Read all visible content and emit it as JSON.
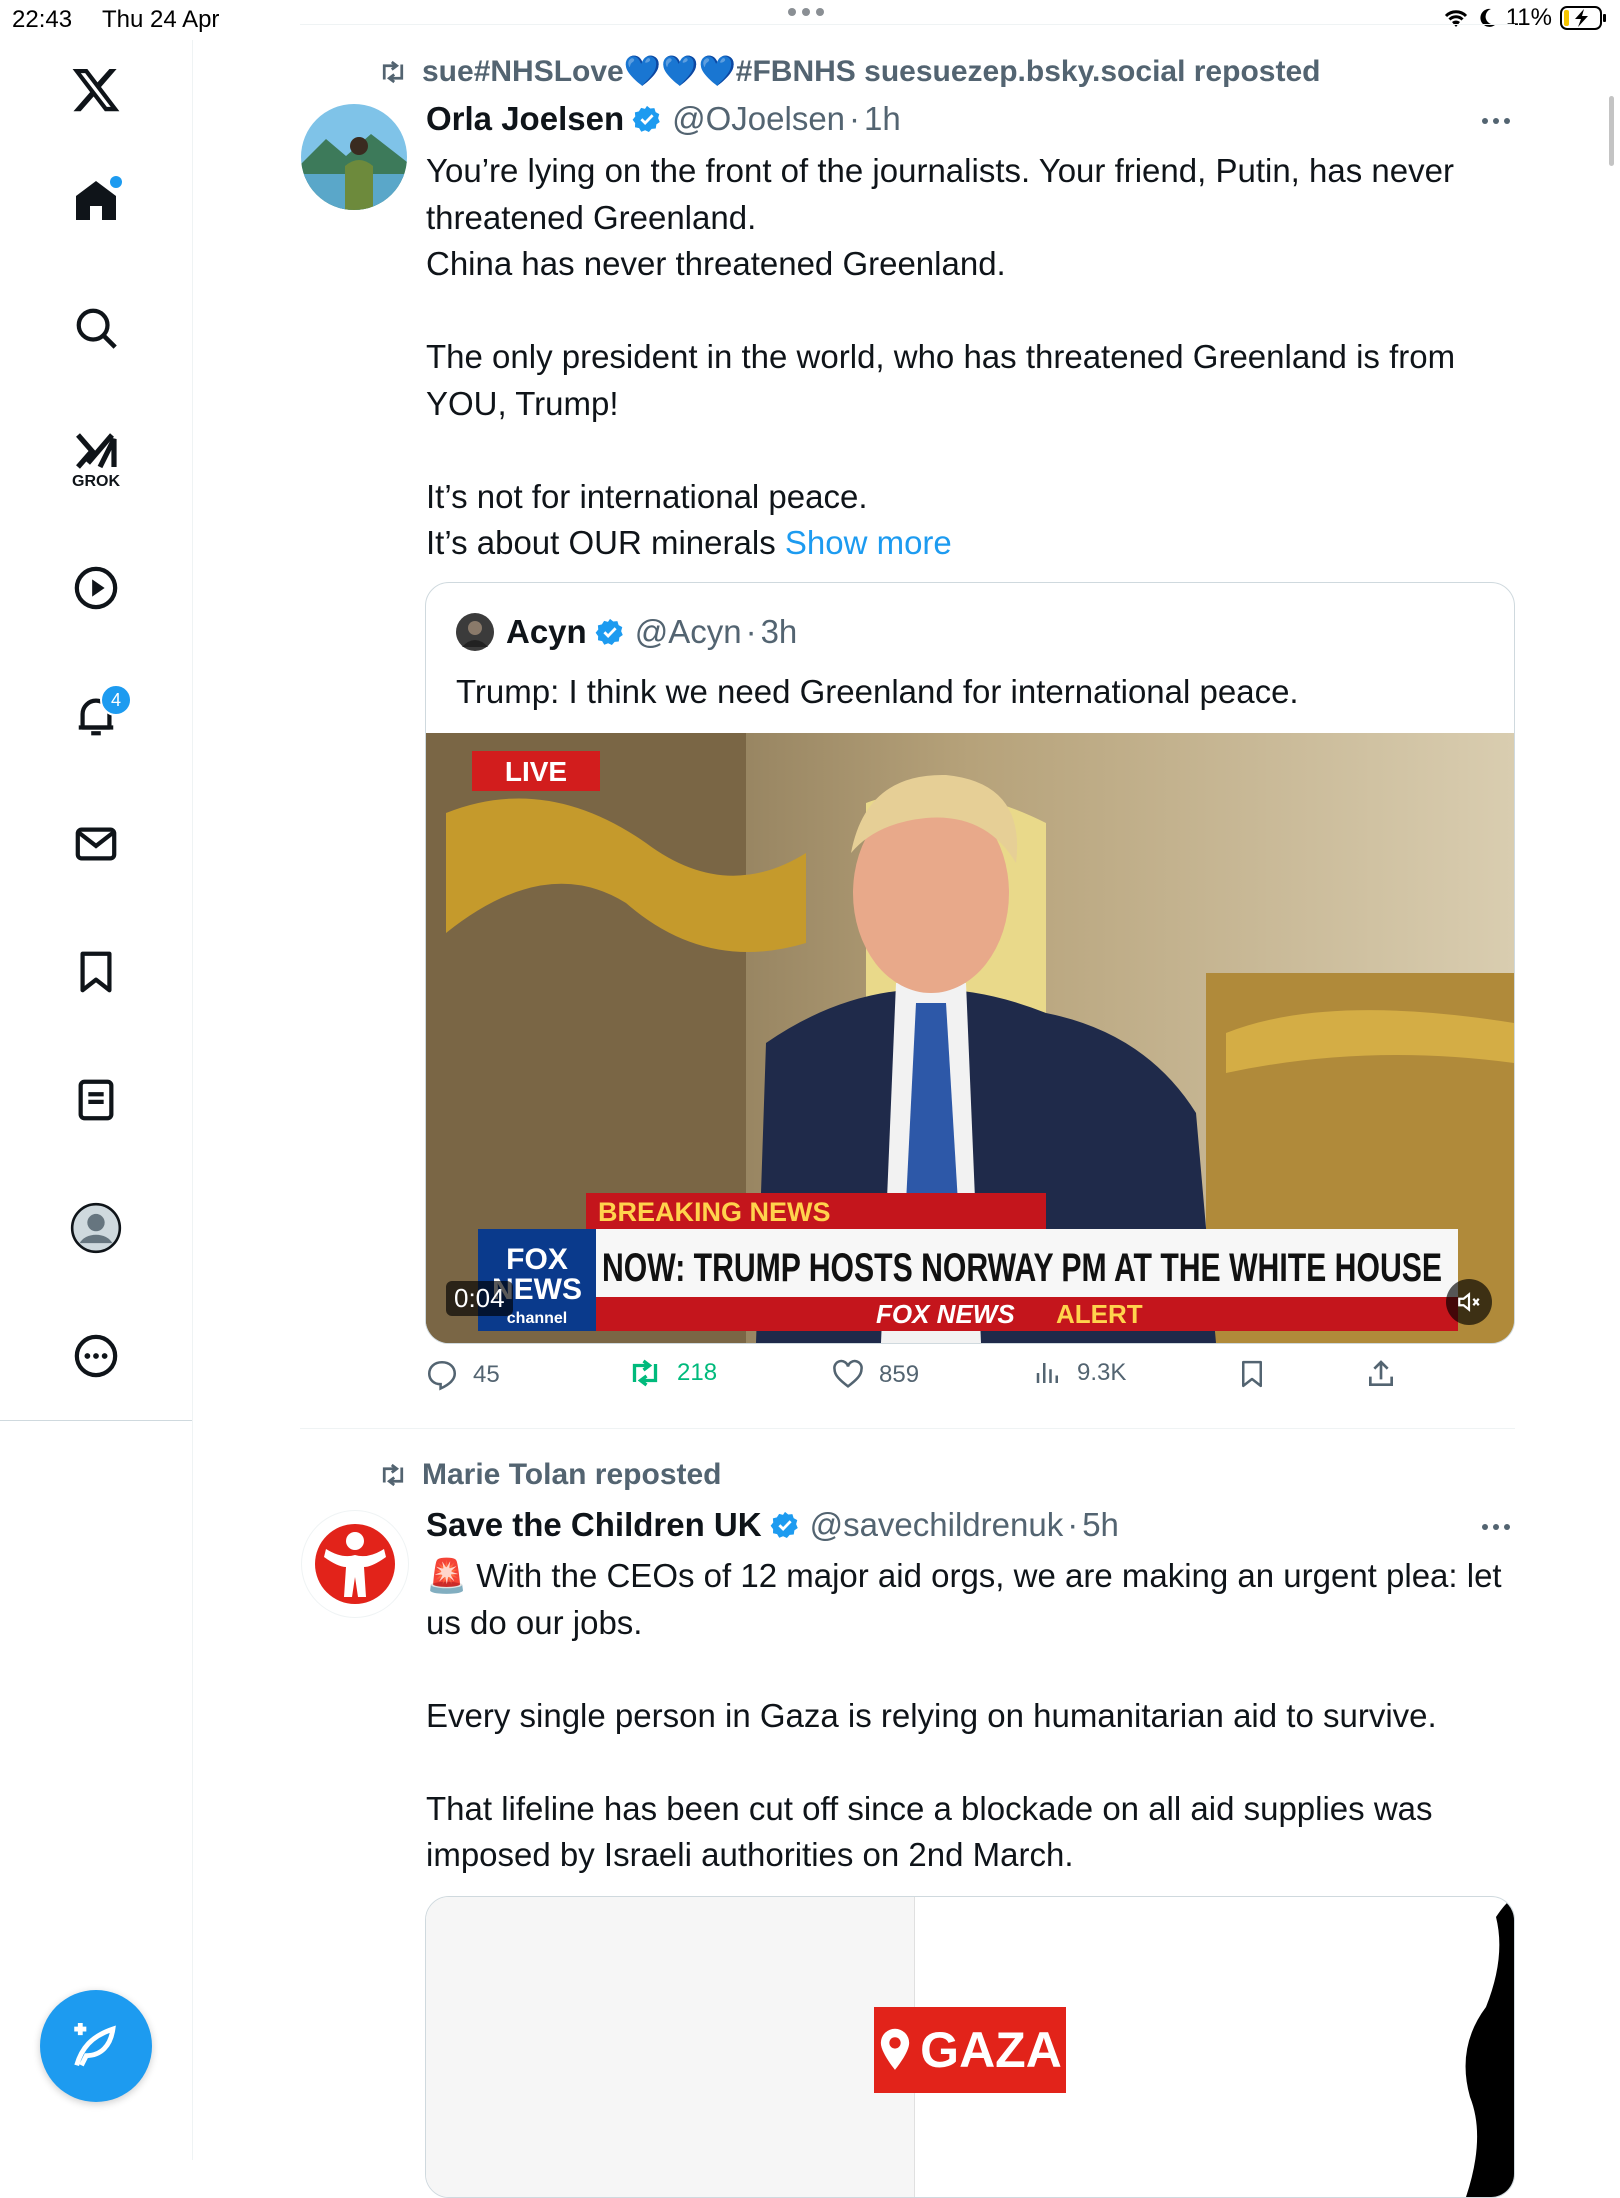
{
  "status_bar": {
    "time": "22:43",
    "date": "Thu 24 Apr",
    "battery": "11%"
  },
  "sidebar": {
    "items": [
      {
        "name": "X"
      },
      {
        "name": "Home"
      },
      {
        "name": "Search"
      },
      {
        "name": "GROK"
      },
      {
        "name": "Videos"
      },
      {
        "name": "Notifications",
        "badge": "4"
      },
      {
        "name": "Messages"
      },
      {
        "name": "Bookmarks"
      },
      {
        "name": "Lists"
      },
      {
        "name": "Profile"
      },
      {
        "name": "More"
      }
    ],
    "grok_label": "GROK",
    "notif_badge": "4"
  },
  "posts": [
    {
      "repost_by": "sue#NHSLove💙💙💙#FBNHS suesuezep.bsky.social reposted",
      "author_name": "Orla Joelsen",
      "handle": "@OJoelsen",
      "time": "1h",
      "paragraphs": [
        "You’re lying on the front of the journalists. Your friend, Putin, has never threatened Greenland.",
        "China has never threatened Greenland.",
        "",
        "The only president in the world, who has threatened Greenland is from YOU, Trump!",
        "",
        "It’s not for international peace."
      ],
      "last_line": "It’s about OUR minerals",
      "show_more": "Show more",
      "quote": {
        "author_name": "Acyn",
        "handle": "@Acyn",
        "time": "3h",
        "text": "Trump: I think we need Greenland for international peace.",
        "video": {
          "live": "LIVE",
          "breaking": "BREAKING NEWS",
          "headline": "NOW: TRUMP HOSTS NORWAY PM AT THE WHITE HOUSE",
          "alert_a": "FOX NEWS",
          "alert_b": "ALERT",
          "logo_a": "FOX",
          "logo_b": "NEWS",
          "logo_c": "channel",
          "timestamp": "0:04"
        }
      },
      "stats": {
        "replies": "45",
        "reposts": "218",
        "likes": "859",
        "views": "9.3K"
      }
    },
    {
      "repost_by": "Marie Tolan reposted",
      "author_name": "Save the Children UK",
      "handle": "@savechildrenuk",
      "time": "5h",
      "line1_emoji": "🚨",
      "paragraphs": [
        "With the CEOs of 12 major aid orgs, we are making an urgent plea: let us do our jobs.",
        "",
        "Every single person in Gaza is relying on humanitarian aid to survive.",
        "",
        "That lifeline has been cut off since a blockade on all aid supplies was imposed by Israeli authorities on 2nd March."
      ],
      "media_label": "GAZA"
    }
  ],
  "colors": {
    "accent": "#1d9bf0",
    "repost_green": "#00ba7c",
    "muted": "#536471",
    "save_red": "#e2231a"
  }
}
